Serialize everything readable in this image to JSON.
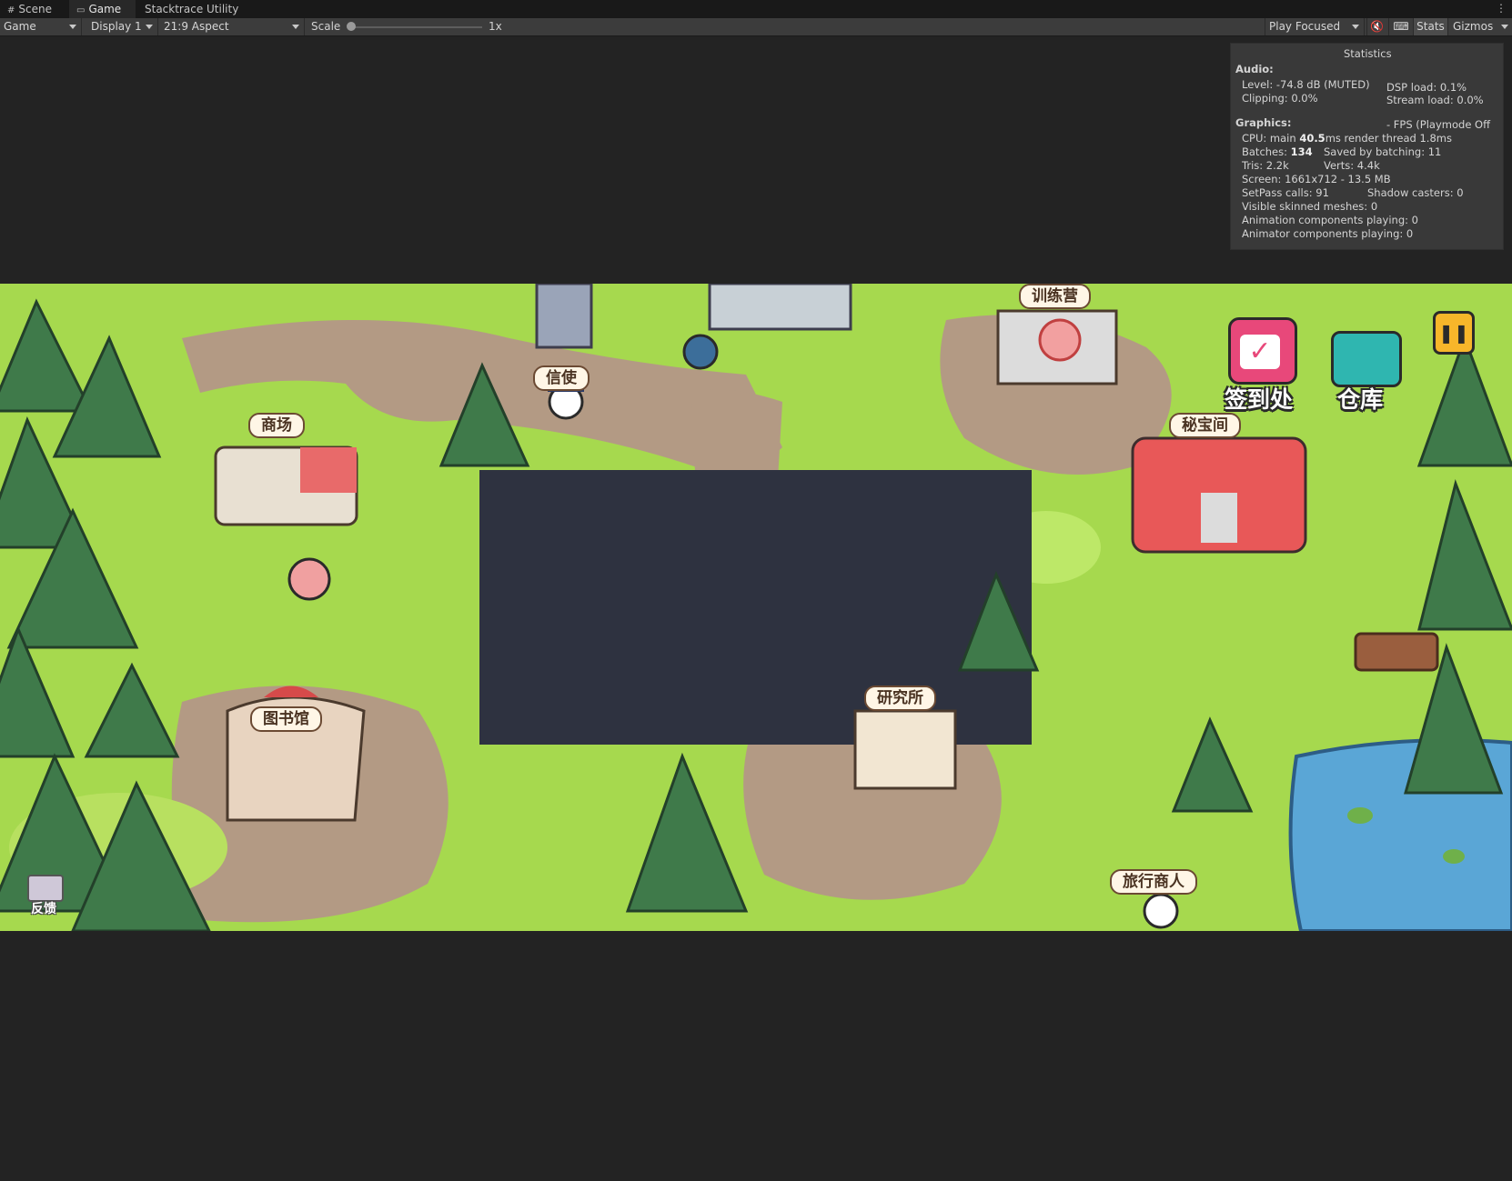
{
  "tabs": [
    {
      "label": "Scene",
      "icon": "grid-icon"
    },
    {
      "label": "Game",
      "icon": "gamepad-icon"
    },
    {
      "label": "Stacktrace Utility"
    }
  ],
  "toolbar": {
    "view": "Game",
    "display": "Display 1",
    "aspect": "21:9 Aspect",
    "scale_label": "Scale",
    "scale_value": "1x",
    "scale_slider": 0.0,
    "play_mode": "Play Focused",
    "stats_label": "Stats",
    "stats_active": true,
    "gizmos_label": "Gizmos"
  },
  "stats": {
    "title": "Statistics",
    "audio_header": "Audio:",
    "level": "Level: -74.8 dB (MUTED)",
    "clipping": "Clipping: 0.0%",
    "dsp": "DSP load: 0.1%",
    "stream": "Stream load: 0.0%",
    "graphics_header": "Graphics:",
    "fps": "- FPS (Playmode Off",
    "cpu_a": "CPU: main ",
    "cpu_b": "40.5",
    "cpu_c": "ms  render thread 1.8ms",
    "batches_a": "Batches: ",
    "batches_b": "134",
    "saved": "Saved by batching: 11",
    "tris": "Tris: 2.2k",
    "verts": "Verts: 4.4k",
    "screen": "Screen: 1661x712 - 13.5 MB",
    "setpass": "SetPass calls: 91",
    "shadow": "Shadow casters: 0",
    "skinned": "Visible skinned meshes: 0",
    "anim": "Animation components playing: 0",
    "animator": "Animator components playing: 0"
  },
  "game": {
    "signs": {
      "training": "训练营",
      "messenger": "信使",
      "mall": "商场",
      "treasure": "秘宝间",
      "library": "图书馆",
      "research": "研究所",
      "merchant": "旅行商人"
    },
    "hud": {
      "checkin": "签到处",
      "warehouse": "仓库",
      "feedback": "反馈"
    },
    "colors": {
      "grass": "#a6d94e",
      "path": "#b39a84",
      "tree": "#3f7a4a",
      "dark_tile": "#2e3240",
      "water": "#5aa6d6"
    }
  }
}
